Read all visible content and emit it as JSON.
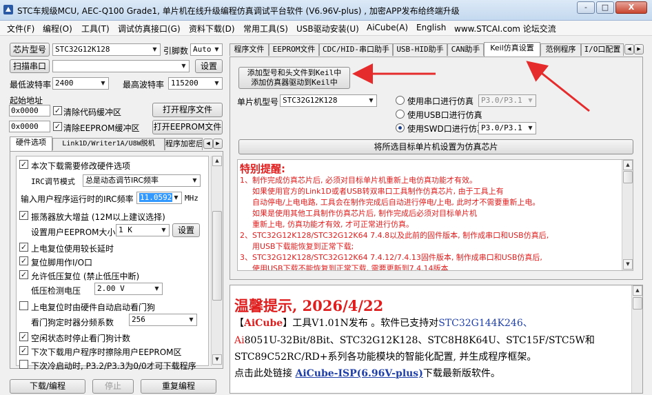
{
  "window": {
    "title": "STC车规级MCU, AEC-Q100 Grade1, 单片机在线升级编程仿真调试平台软件 (V6.96V-plus) , 加密APP发布给终端升级",
    "minimize": "-",
    "maximize": "□",
    "close": "X"
  },
  "menu": [
    "文件(F)",
    "编程(O)",
    "工具(T)",
    "调试仿真接口(G)",
    "资料下载(D)",
    "常用工具(S)",
    "USB驱动安装(U)",
    "AiCube(A)",
    "English",
    "www.STCAI.com 论坛交流"
  ],
  "left": {
    "chip_model_btn": "芯片型号",
    "chip_model": "STC32G12K128",
    "pin_label": "引脚数",
    "pin_value": "Auto",
    "scan_port_btn": "扫描串口",
    "port_value": "",
    "settings_btn": "设置",
    "min_baud_label": "最低波特率",
    "min_baud": "2400",
    "max_baud_label": "最高波特率",
    "max_baud": "115200",
    "start_addr_label": "起始地址",
    "addr1": "0x0000",
    "clear_code_label": "清除代码缓冲区",
    "open_prog_btn": "打开程序文件",
    "addr2": "0x0000",
    "clear_eeprom_label": "清除EEPROM缓冲区",
    "open_eeprom_btn": "打开EEPROM文件",
    "tabs": [
      "硬件选项",
      "Link1D/Writer1A/U8W脱机",
      "程序加密后"
    ],
    "hw": {
      "modify_hw": "本次下载需要修改硬件选项",
      "irc_mode_label": "IRC调节模式",
      "irc_mode": "总是动态调节IRC频率",
      "irc_freq_label": "输入用户程序运行时的IRC频率",
      "irc_freq": "11.0592",
      "irc_unit": "MHz",
      "osc_gain": "振荡器放大增益 (12M以上建议选择)",
      "eeprom_size_label": "设置用户EEPROM大小",
      "eeprom_size": "1 K",
      "eeprom_set_btn": "设置",
      "long_reset": "上电复位使用较长延时",
      "reset_pin_io": "复位脚用作I/O口",
      "lvr": "允许低压复位 (禁止低压中断)",
      "lv_detect_label": "低压检测电压",
      "lv_detect": "2.00 V",
      "wdt_hw": "上电复位时由硬件自动启动看门狗",
      "wdt_div_label": "看门狗定时器分频系数",
      "wdt_div": "256",
      "idle_wdt": "空闲状态时停止看门狗计数",
      "erase_eeprom": "下次下载用户程序时擦除用户EEPROM区",
      "cold_boot": "下次冷启动时, P3.2/P3.3为0/0才可下载程序"
    },
    "download_btn": "下载/编程",
    "stop_btn": "停止",
    "reprogram_btn": "重复编程"
  },
  "right": {
    "tabs": [
      "程序文件",
      "EEPROM文件",
      "CDC/HID-串口助手",
      "USB-HID助手",
      "CAN助手",
      "Keil仿真设置",
      "范例程序",
      "I/O口配置"
    ],
    "add_keil_btn_l1": "添加型号和头文件到Keil中",
    "add_keil_btn_l2": "添加仿真器驱动到Keil中",
    "mcu_model_label": "单片机型号",
    "mcu_model": "STC32G12K128",
    "serial_sim_label": "使用串口进行仿真",
    "serial_sim_port": "P3.0/P3.1",
    "usb_sim_label": "使用USB口进行仿真",
    "swd_sim_label": "使用SWD口进行仿真",
    "swd_sim_port": "P3.0/P3.1",
    "set_sim_chip_btn": "将所选目标单片机设置为仿真芯片",
    "notice_title": "特别提醒:",
    "notice_lines": [
      "1、制作完成仿真芯片后, 必须对目标单片机重新上电仿真功能才有效。",
      "如果使用官方的Link1D或者USB转双串口工具制作仿真芯片, 由于工具上有",
      "自动停电/上电电路, 工具会在制作完成后自动进行停电/上电, 此时才不需要重新上电。",
      "如果是使用其他工具制作仿真芯片后, 制作完成后必须对目标单片机",
      "重新上电, 仿真功能才有效, 才可正常进行仿真。",
      "2、STC32G12K128/STC32G12K64  7.4.8以及此前的固件版本, 制作成串口和USB仿真后,",
      "用USB下载能恢复到正常下载;",
      "3、STC32G12K128/STC32G12K64  7.4.12/7.4.13固件版本, 制作成串口和USB仿真后,",
      "使用USB下载不能恢复到正常下载, 需要更新到7.4.14版本"
    ]
  },
  "news": {
    "title": "温馨提示, 2026/4/22",
    "l1_bracket_open": "【",
    "l1_aicube": "AiCube",
    "l1_rest": "】工具V1.01N发布 。软件已支持对",
    "l1_chip": "STC32G144K246、",
    "l2_ai": "Ai",
    "l2_rest": "8051U-32Bit/8Bit、STC32G12K128、STC8H8K64U、STC15F/STC5W和",
    "l3": "STC89C52RC/RD+系列各功能模块的智能化配置, 并生成程序框架。",
    "l4_pre": "点击此处链接 ",
    "l4_link": "AiCube-ISP(6.96V-plus)",
    "l4_post": "下载最新版软件。"
  },
  "colors": {
    "accent_red": "#e01d1d",
    "link_blue": "#1f3fa8",
    "highlight": "#3399ff"
  }
}
